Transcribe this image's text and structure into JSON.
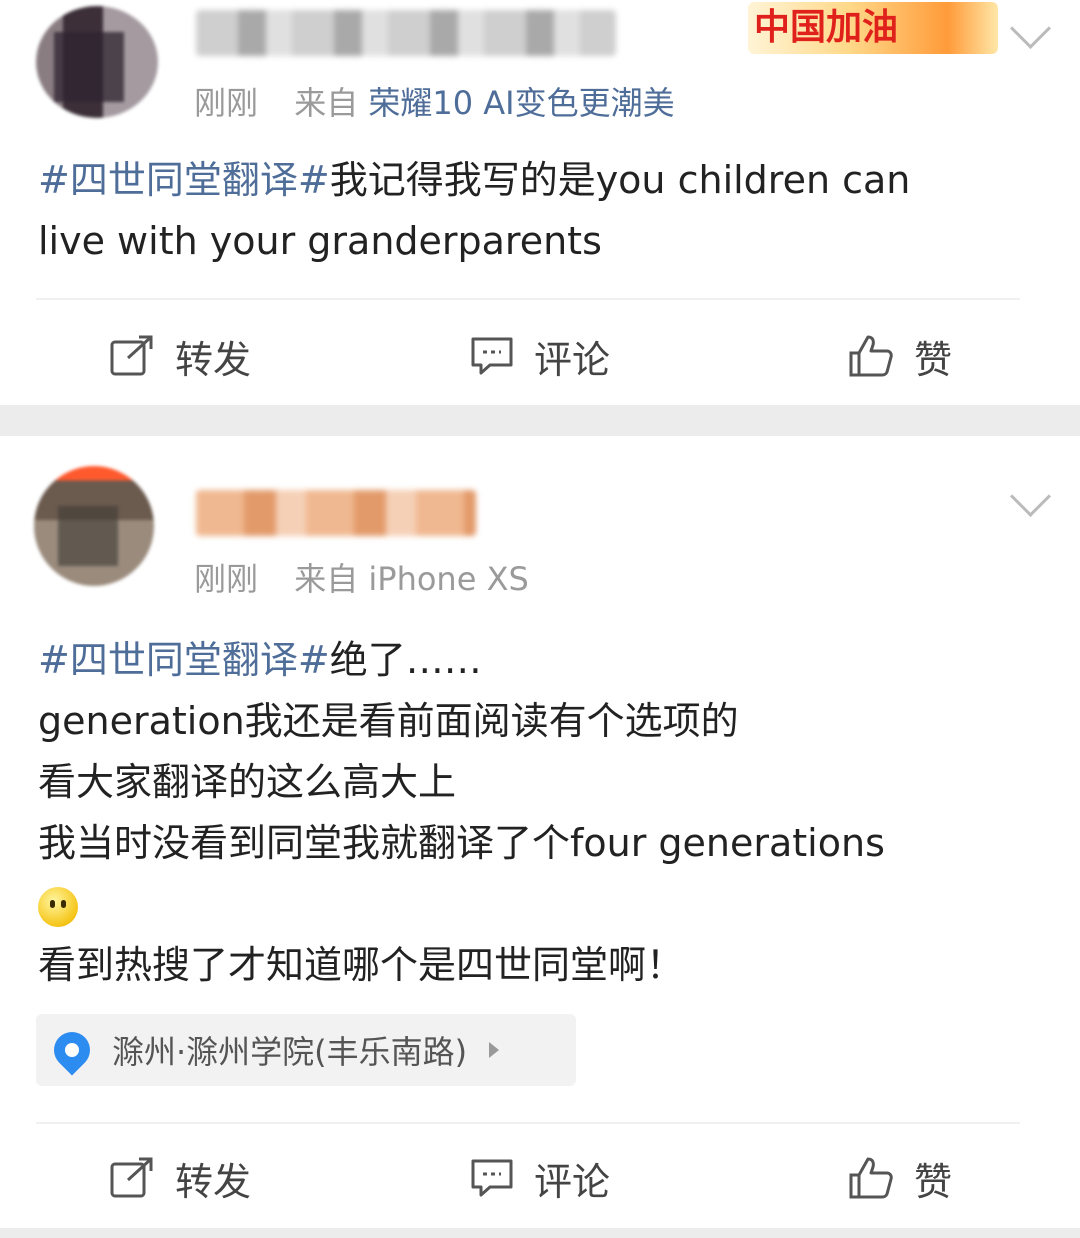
{
  "posts": [
    {
      "time": "刚刚",
      "from_label": "来自",
      "device": "荣耀10 AI变色更潮美",
      "badge_text": "中国加油",
      "hashtag": "#四世同堂翻译#",
      "lines": [
        "我记得我写的是you children can",
        "live with your granderparents"
      ],
      "actions": {
        "repost": "转发",
        "comment": "评论",
        "like": "赞"
      }
    },
    {
      "time": "刚刚",
      "from_label": "来自",
      "device": "iPhone XS",
      "hashtag": "#四世同堂翻译#",
      "first_line_rest": "绝了……",
      "lines": [
        "generation我还是看前面阅读有个选项的",
        "看大家翻译的这么高大上",
        "我当时没看到同堂我就翻译了个four generations",
        "看到热搜了才知道哪个是四世同堂啊！"
      ],
      "location": "滁州·滁州学院(丰乐南路)",
      "actions": {
        "repost": "转发",
        "comment": "评论",
        "like": "赞"
      }
    }
  ],
  "icons": {
    "repost": "external-share-icon",
    "comment": "comment-bubble-icon",
    "like": "thumbs-up-icon",
    "location": "map-pin-icon",
    "more": "chevron-down-icon",
    "emoji": "smiley-emoji-icon"
  },
  "colors": {
    "hashtag": "#4e6d98",
    "meta": "#9a9a9a",
    "separator": "#ececec",
    "location_pin": "#2d8cf0"
  }
}
